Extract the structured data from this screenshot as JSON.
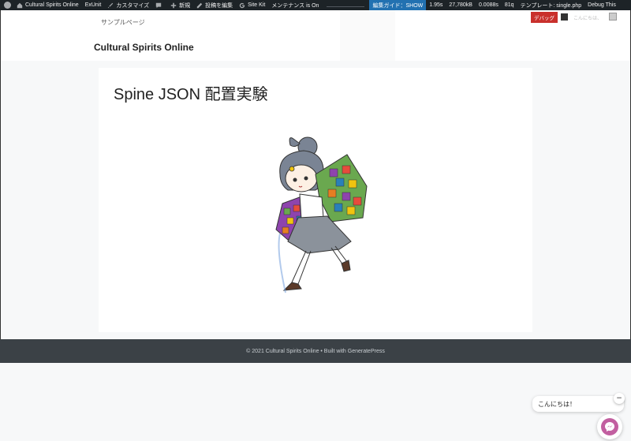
{
  "adminbar": {
    "site_name": "Cultural Spirits Online",
    "exunit": "ExUnit",
    "customize": "カスタマイズ",
    "new": "新規",
    "edit_post": "投稿を編集",
    "site_kit": "Site Kit",
    "maintenance": "メンテナンス is On",
    "edit_guide": "編集ガイド：SHOW",
    "time": "1.95s",
    "memory": "27,780kB",
    "query_time": "0.0088s",
    "queries": "81q",
    "template": "テンプレート: single.php",
    "debug_this": "Debug This"
  },
  "header": {
    "nav_item": "サンプルページ",
    "site_title": "Cultural Spirits Online",
    "debug_button": "デバッグ",
    "user_greeting": "こんにちは、"
  },
  "article": {
    "title": "Spine JSON 配置実験"
  },
  "footer": {
    "text": "© 2021 Cultural Spirits Online • Built with GeneratePress"
  },
  "chat": {
    "greeting": "こんにちは！",
    "close_symbol": "−"
  },
  "colors": {
    "adminbar_bg": "#1d2327",
    "highlight": "#2271b1",
    "debug_red": "#c9302c",
    "footer_bg": "#3b4146",
    "messenger": "#c25fa0"
  }
}
